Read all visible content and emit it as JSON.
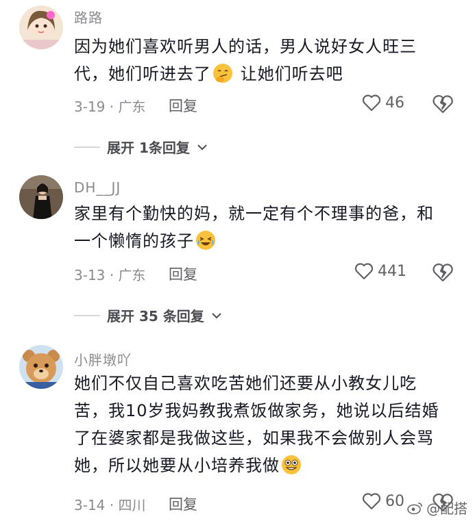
{
  "comments": [
    {
      "username": "路路",
      "line1": "因为她们喜欢听男人的话，男人说好女人旺三",
      "line2_a": "代，她们听进去了",
      "line2_b": " 让她们听去吧",
      "date_location": "3-19 · 广东",
      "reply_label": "回复",
      "likes": "46",
      "expand_label": "展开 1条回复",
      "emoji_icon": "smirk-emoji-icon"
    },
    {
      "username": "DH__JJ",
      "line1": "家里有个勤快的妈，就一定有个不理事的爸，和",
      "line2_a": "一个懒惰的孩子",
      "date_location": "3-13 · 广东",
      "reply_label": "回复",
      "likes": "441",
      "expand_label": "展开 35 条回复",
      "emoji_icon": "laugh-cry-emoji-icon"
    },
    {
      "username": "小胖墩吖",
      "line1": "她们不仅自己喜欢吃苦她们还要从小教女儿吃",
      "line2": "苦，我10岁我妈教我煮饭做家务，她说以后结婚",
      "line3": "了在婆家都是我做这些，如果我不会做别人会骂",
      "line4_a": "她，所以她要从小培养我做",
      "date_location": "3-14 · 四川",
      "reply_label": "回复",
      "likes": "60",
      "emoji_icon": "silly-grin-emoji-icon"
    }
  ],
  "watermark": "@配搭",
  "colors": {
    "text": "#161823",
    "meta": "#8a8b91",
    "emoji_yellow": "#f9c23c"
  }
}
